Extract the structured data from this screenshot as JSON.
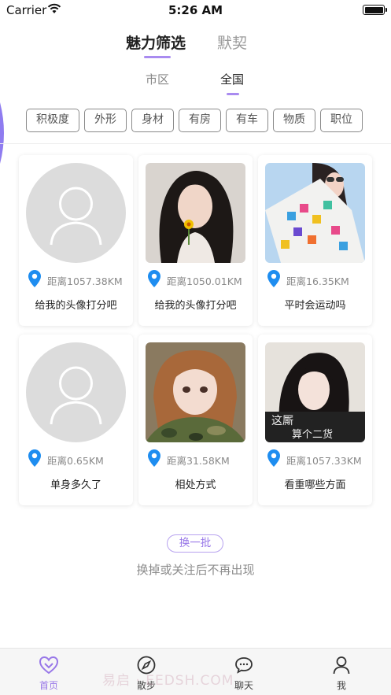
{
  "status_bar": {
    "carrier": "Carrier",
    "time": "5:26 AM",
    "battery_level": 1.0
  },
  "top_tabs": [
    {
      "label": "魅力筛选",
      "active": true
    },
    {
      "label": "默契",
      "active": false
    }
  ],
  "sub_tabs": [
    {
      "label": "市区",
      "active": false
    },
    {
      "label": "全国",
      "active": true
    }
  ],
  "filters": [
    "积极度",
    "外形",
    "身材",
    "有房",
    "有车",
    "物质",
    "职位"
  ],
  "cards": [
    {
      "photo": "default-avatar",
      "distance": "距离1057.38KM",
      "caption": "给我的头像打分吧"
    },
    {
      "photo": "girl-flower-photo",
      "distance": "距离1050.01KM",
      "caption": "给我的头像打分吧"
    },
    {
      "photo": "girl-colorful-jacket-photo",
      "distance": "距离16.35KM",
      "caption": "平时会运动吗"
    },
    {
      "photo": "default-avatar",
      "distance": "距离0.65KM",
      "caption": "单身多久了"
    },
    {
      "photo": "girl-camouflage-photo",
      "distance": "距离31.58KM",
      "caption": "相处方式"
    },
    {
      "photo": "girl-sticker-photo",
      "distance": "距离1057.33KM",
      "caption": "看重哪些方面"
    }
  ],
  "photo_texts": {
    "sticker_line1": "这厮",
    "sticker_line2": "算个二货"
  },
  "refresh_label": "换一批",
  "hint": "换掉或关注后不再出现",
  "bottom_nav": [
    {
      "label": "首页",
      "icon": "heart-icon",
      "active": true
    },
    {
      "label": "散步",
      "icon": "compass-icon",
      "active": false
    },
    {
      "label": "聊天",
      "icon": "chat-bubble-icon",
      "active": false
    },
    {
      "label": "我",
      "icon": "person-icon",
      "active": false
    }
  ],
  "watermark": "易启 · EEDSH.COM",
  "colors": {
    "accent": "#9877e8",
    "underline": "#a98bf0",
    "pin": "#1e8df0"
  }
}
